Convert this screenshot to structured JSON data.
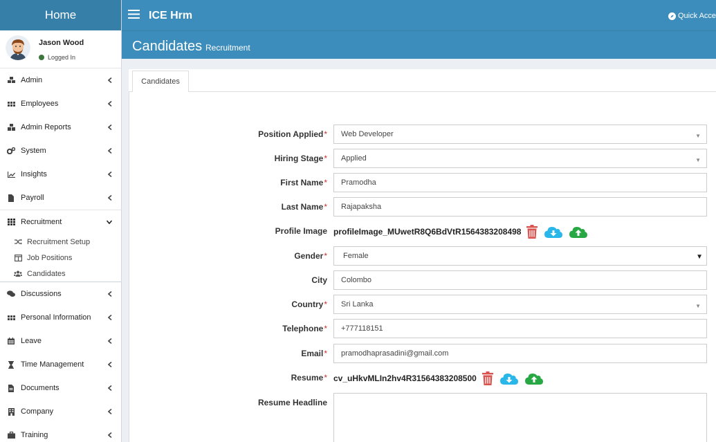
{
  "sidebar": {
    "brand": "Home",
    "user": {
      "name": "Jason Wood",
      "status": "Logged In"
    },
    "items": [
      {
        "label": "Admin"
      },
      {
        "label": "Employees"
      },
      {
        "label": "Admin Reports"
      },
      {
        "label": "System"
      },
      {
        "label": "Insights"
      },
      {
        "label": "Payroll"
      },
      {
        "label": "Recruitment"
      },
      {
        "label": "Discussions"
      },
      {
        "label": "Personal Information"
      },
      {
        "label": "Leave"
      },
      {
        "label": "Time Management"
      },
      {
        "label": "Documents"
      },
      {
        "label": "Company"
      },
      {
        "label": "Training"
      }
    ],
    "recruitment_sub": [
      {
        "label": "Recruitment Setup"
      },
      {
        "label": "Job Positions"
      },
      {
        "label": "Candidates"
      }
    ]
  },
  "header": {
    "app_title": "ICE Hrm",
    "quick_access": "Quick Acce"
  },
  "page": {
    "title": "Candidates",
    "subtitle": "Recruitment"
  },
  "tabs": [
    {
      "label": "Candidates"
    }
  ],
  "form": {
    "position_applied": {
      "label": "Position Applied",
      "value": "Web Developer"
    },
    "hiring_stage": {
      "label": "Hiring Stage",
      "value": "Applied"
    },
    "first_name": {
      "label": "First Name",
      "value": "Pramodha"
    },
    "last_name": {
      "label": "Last Name",
      "value": "Rajapaksha"
    },
    "profile_image": {
      "label": "Profile Image",
      "value": "profileImage_MUwetR8Q6BdVtR1564383208498"
    },
    "gender": {
      "label": "Gender",
      "value": "Female"
    },
    "city": {
      "label": "City",
      "value": "Colombo"
    },
    "country": {
      "label": "Country",
      "value": "Sri Lanka"
    },
    "telephone": {
      "label": "Telephone",
      "value": "+777118151"
    },
    "email": {
      "label": "Email",
      "value": "pramodhaprasadini@gmail.com"
    },
    "resume": {
      "label": "Resume",
      "value": "cv_uHkvMLIn2hv4R31564383208500"
    },
    "resume_headline": {
      "label": "Resume Headline",
      "value": ""
    }
  },
  "colors": {
    "header": "#3c8dbc",
    "brand": "#367fa9",
    "delete": "#d9534f",
    "download": "#29b6e8",
    "upload": "#28a745"
  }
}
